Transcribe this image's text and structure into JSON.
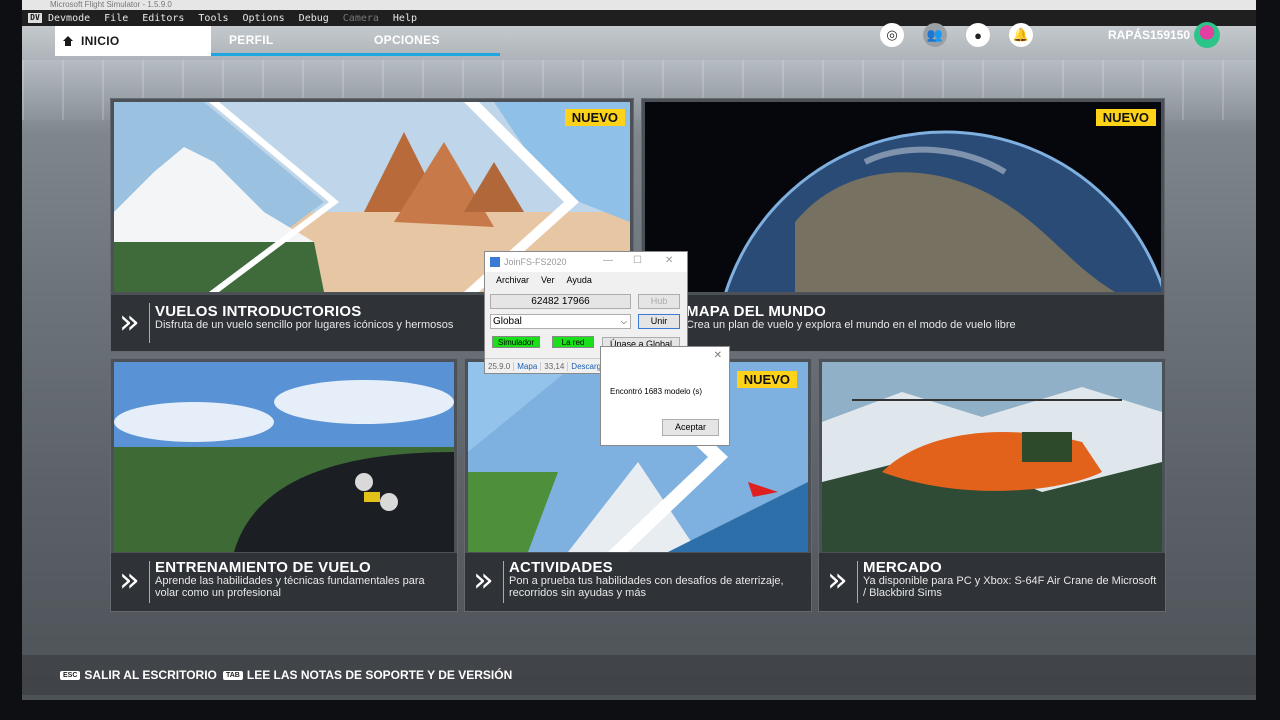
{
  "window_title": "Microsoft Flight Simulator - 1.5.9.0",
  "devbar": {
    "logo": "DV",
    "items": [
      "Devmode",
      "File",
      "Editors",
      "Tools",
      "Options",
      "Debug",
      "Camera",
      "Help"
    ]
  },
  "nav": {
    "tabs": [
      "INICIO",
      "PERFIL",
      "OPCIONES"
    ]
  },
  "user": {
    "name": "RAPÁS159150"
  },
  "top_icons": [
    "target-icon",
    "group-icon",
    "profile-icon",
    "bell-icon"
  ],
  "cards": [
    {
      "title": "VUELOS INTRODUCTORIOS",
      "desc": "Disfruta de un vuelo sencillo por lugares icónicos y hermosos",
      "badge": "NUEVO"
    },
    {
      "title": "MAPA DEL MUNDO",
      "desc": "Crea un plan de vuelo y explora el mundo en el modo de vuelo libre",
      "badge": "NUEVO"
    },
    {
      "title": "ENTRENAMIENTO DE VUELO",
      "desc": "Aprende las habilidades y técnicas fundamentales para volar como un profesional"
    },
    {
      "title": "ACTIVIDADES",
      "desc": "Pon a prueba tus habilidades con desafíos de aterrizaje, recorridos sin ayudas y más",
      "badge": "NUEVO"
    },
    {
      "title": "MERCADO",
      "desc": "Ya disponible para PC y Xbox: S-64F Air Crane de Microsoft / Blackbird Sims"
    }
  ],
  "footer": {
    "esc_key": "ESC",
    "esc_label": "SALIR AL ESCRITORIO",
    "tab_key": "TAB",
    "tab_label": "LEE LAS NOTAS DE SOPORTE Y DE VERSIÓN"
  },
  "joinfs": {
    "title": "JoinFS-FS2020",
    "menu": [
      "Archivar",
      "Ver",
      "Ayuda"
    ],
    "code": "62482 17966",
    "hub": "Hub",
    "network": "Global",
    "join": "Unir",
    "sim": "Simulador",
    "net": "La red",
    "join_global": "Únase a Global",
    "status": [
      "25.9.0",
      "Mapa",
      "33,14",
      "Descargar"
    ]
  },
  "dialog": {
    "message": "Encontró 1683 modelo (s)",
    "ok": "Aceptar"
  }
}
